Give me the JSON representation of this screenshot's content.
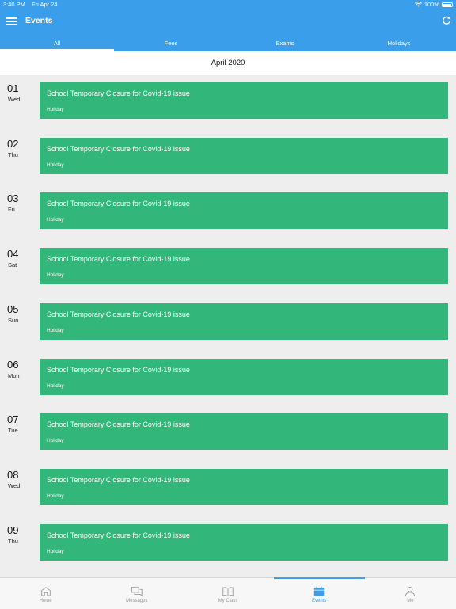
{
  "status": {
    "time": "3:40 PM",
    "date": "Fri Apr 24",
    "battery": "100%"
  },
  "nav": {
    "title": "Events"
  },
  "tabs": [
    "All",
    "Fees",
    "Exams",
    "Holidays"
  ],
  "active_tab": "All",
  "month": "April 2020",
  "events": [
    {
      "day": "01",
      "weekday": "Wed",
      "title": "School Temporary Closure for Covid-19 issue",
      "type": "Holiday"
    },
    {
      "day": "02",
      "weekday": "Thu",
      "title": "School Temporary Closure for Covid-19 issue",
      "type": "Holiday"
    },
    {
      "day": "03",
      "weekday": "Fri",
      "title": "School Temporary Closure for Covid-19 issue",
      "type": "Holiday"
    },
    {
      "day": "04",
      "weekday": "Sat",
      "title": "School Temporary Closure for Covid-19 issue",
      "type": "Holiday"
    },
    {
      "day": "05",
      "weekday": "Sun",
      "title": "School Temporary Closure for Covid-19 issue",
      "type": "Holiday"
    },
    {
      "day": "06",
      "weekday": "Mon",
      "title": "School Temporary Closure for Covid-19 issue",
      "type": "Holiday"
    },
    {
      "day": "07",
      "weekday": "Tue",
      "title": "School Temporary Closure for Covid-19 issue",
      "type": "Holiday"
    },
    {
      "day": "08",
      "weekday": "Wed",
      "title": "School Temporary Closure for Covid-19 issue",
      "type": "Holiday"
    },
    {
      "day": "09",
      "weekday": "Thu",
      "title": "School Temporary Closure for Covid-19 issue",
      "type": "Holiday"
    }
  ],
  "bottom_tabs": [
    {
      "label": "Home",
      "icon": "home-icon"
    },
    {
      "label": "Messages",
      "icon": "messages-icon"
    },
    {
      "label": "My Class",
      "icon": "book-icon"
    },
    {
      "label": "Events",
      "icon": "calendar-icon"
    },
    {
      "label": "Me",
      "icon": "person-icon"
    }
  ],
  "active_bottom_tab": "Events",
  "colors": {
    "primary": "#3a9eea",
    "card": "#33b679",
    "background": "#eeeeee",
    "inactive": "#999999"
  }
}
